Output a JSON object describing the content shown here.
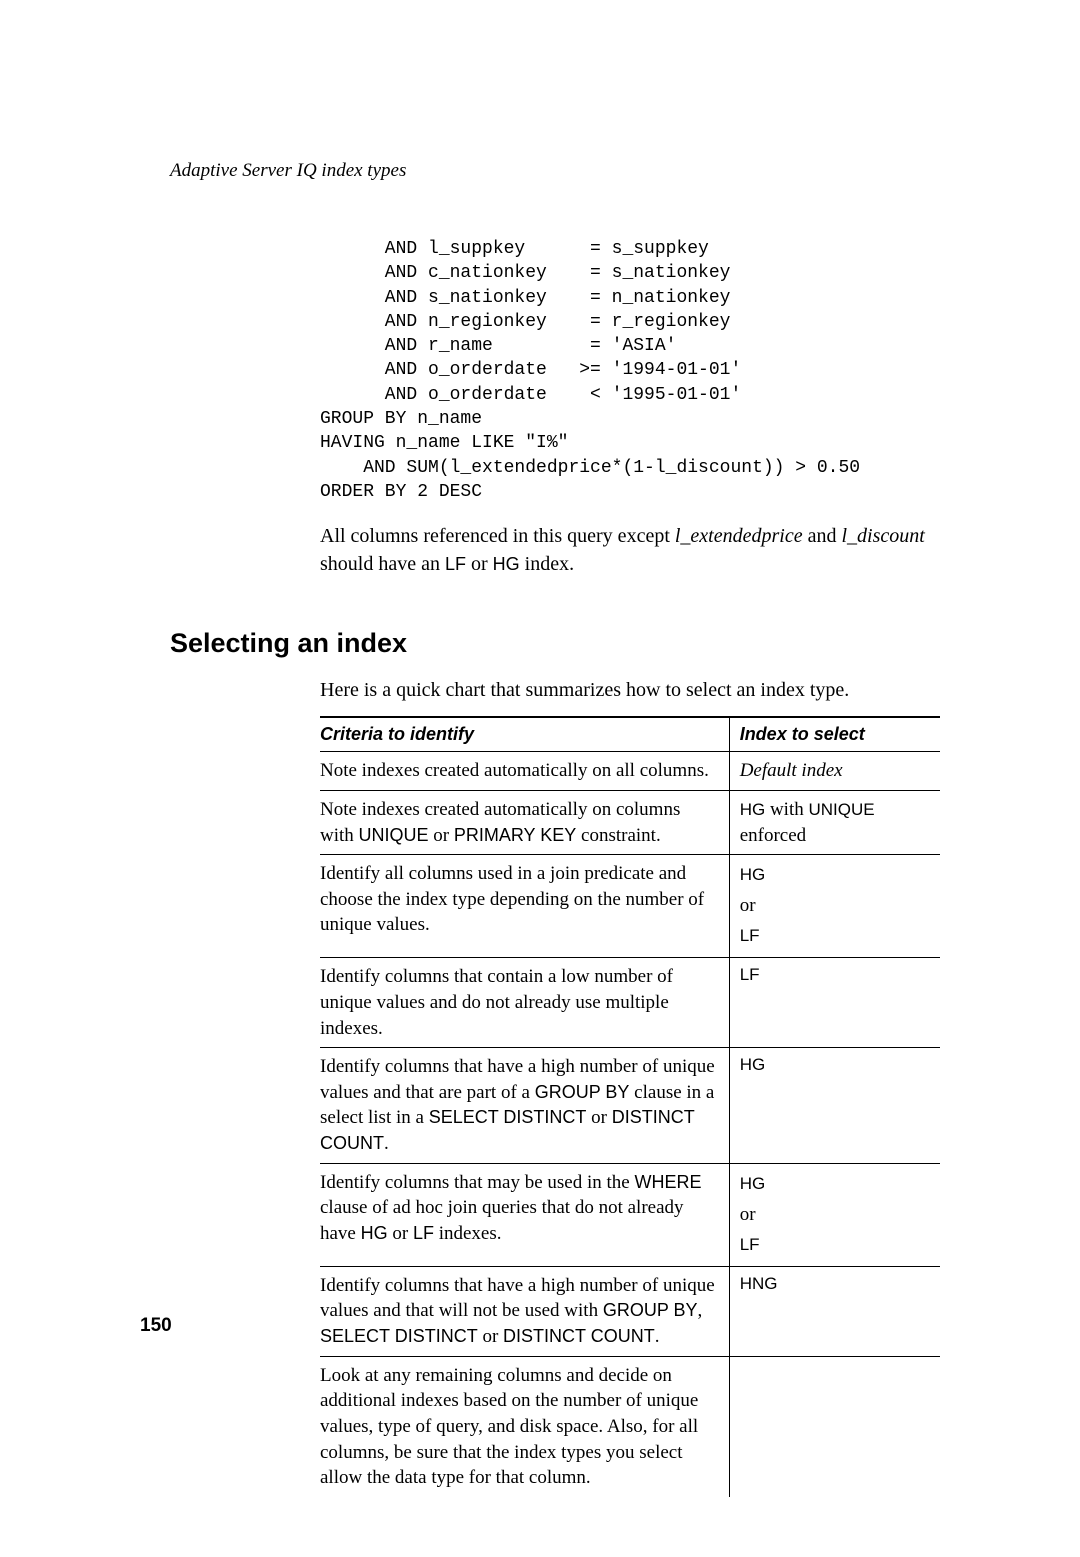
{
  "header": "Adaptive Server IQ index types",
  "code": "      AND l_suppkey      = s_suppkey\n      AND c_nationkey    = s_nationkey\n      AND s_nationkey    = n_nationkey\n      AND n_regionkey    = r_regionkey\n      AND r_name         = 'ASIA'\n      AND o_orderdate   >= '1994-01-01'\n      AND o_orderdate    < '1995-01-01'\nGROUP BY n_name\nHAVING n_name LIKE \"I%\"\n    AND SUM(l_extendedprice*(1-l_discount)) > 0.50\nORDER BY 2 DESC",
  "paragraph": {
    "part1": "All columns referenced in this query except ",
    "em1": "l_extendedprice",
    "part2": " and ",
    "em2": "l_discount",
    "part3": " should have an ",
    "code1": "LF",
    "part4": " or ",
    "code2": "HG",
    "part5": " index."
  },
  "section_heading": "Selecting an index",
  "intro": "Here is a quick chart that summarizes how to select an index type.",
  "table": {
    "headers": [
      "Criteria to identify",
      "Index to select"
    ],
    "rows": [
      {
        "criteria_parts": [
          {
            "t": "text",
            "v": "Note indexes created automatically on all columns."
          }
        ],
        "index_parts": [
          {
            "t": "serif-italic",
            "v": "Default index"
          }
        ]
      },
      {
        "criteria_parts": [
          {
            "t": "text",
            "v": "Note indexes created automatically on columns with "
          },
          {
            "t": "sans",
            "v": "UNIQUE"
          },
          {
            "t": "text",
            "v": " or "
          },
          {
            "t": "sans",
            "v": "PRIMARY KEY"
          },
          {
            "t": "text",
            "v": " constraint."
          }
        ],
        "index_parts": [
          {
            "t": "sans",
            "v": "HG"
          },
          {
            "t": "serif",
            "v": " with "
          },
          {
            "t": "sans",
            "v": "UNIQUE"
          },
          {
            "t": "br"
          },
          {
            "t": "serif",
            "v": "enforced"
          }
        ]
      },
      {
        "criteria_parts": [
          {
            "t": "text",
            "v": "Identify all columns used in a join predicate and choose the index type depending on the number of unique values."
          }
        ],
        "index_parts": [
          {
            "t": "sans",
            "v": "HG"
          },
          {
            "t": "br"
          },
          {
            "t": "serif",
            "v": "or"
          },
          {
            "t": "br"
          },
          {
            "t": "sans",
            "v": "LF"
          }
        ],
        "multi": true
      },
      {
        "criteria_parts": [
          {
            "t": "text",
            "v": "Identify columns that contain a low number of unique values and do not already use multiple indexes."
          }
        ],
        "index_parts": [
          {
            "t": "sans",
            "v": "LF"
          }
        ]
      },
      {
        "criteria_parts": [
          {
            "t": "text",
            "v": "Identify columns that have a high number of unique values and that are part of a "
          },
          {
            "t": "sans",
            "v": "GROUP BY"
          },
          {
            "t": "text",
            "v": " clause in a select list in a "
          },
          {
            "t": "sans",
            "v": "SELECT DISTINCT"
          },
          {
            "t": "text",
            "v": " or "
          },
          {
            "t": "sans",
            "v": "DISTINCT COUNT"
          },
          {
            "t": "text",
            "v": "."
          }
        ],
        "index_parts": [
          {
            "t": "sans",
            "v": "HG"
          }
        ]
      },
      {
        "criteria_parts": [
          {
            "t": "text",
            "v": "Identify columns that may be used in the "
          },
          {
            "t": "sans",
            "v": "WHERE"
          },
          {
            "t": "text",
            "v": " clause of ad hoc join queries that do not already have "
          },
          {
            "t": "sans",
            "v": "HG"
          },
          {
            "t": "text",
            "v": " or "
          },
          {
            "t": "sans",
            "v": "LF"
          },
          {
            "t": "text",
            "v": " indexes."
          }
        ],
        "index_parts": [
          {
            "t": "sans",
            "v": "HG"
          },
          {
            "t": "br"
          },
          {
            "t": "serif",
            "v": "or"
          },
          {
            "t": "br"
          },
          {
            "t": "sans",
            "v": "LF"
          }
        ],
        "multi": true
      },
      {
        "criteria_parts": [
          {
            "t": "text",
            "v": "Identify columns that have a high number of unique values and that will not be used with "
          },
          {
            "t": "sans",
            "v": "GROUP BY"
          },
          {
            "t": "text",
            "v": ", "
          },
          {
            "t": "sans",
            "v": "SELECT DISTINCT"
          },
          {
            "t": "text",
            "v": " or "
          },
          {
            "t": "sans",
            "v": "DISTINCT COUNT"
          },
          {
            "t": "text",
            "v": "."
          }
        ],
        "index_parts": [
          {
            "t": "sans",
            "v": "HNG"
          }
        ]
      },
      {
        "criteria_parts": [
          {
            "t": "text",
            "v": "Look at any remaining columns and decide on additional indexes based on the number of unique values, type of query, and disk space. Also, for all columns, be sure that the index types you select allow the data type for that column."
          }
        ],
        "index_parts": []
      }
    ]
  },
  "page_number": "150"
}
